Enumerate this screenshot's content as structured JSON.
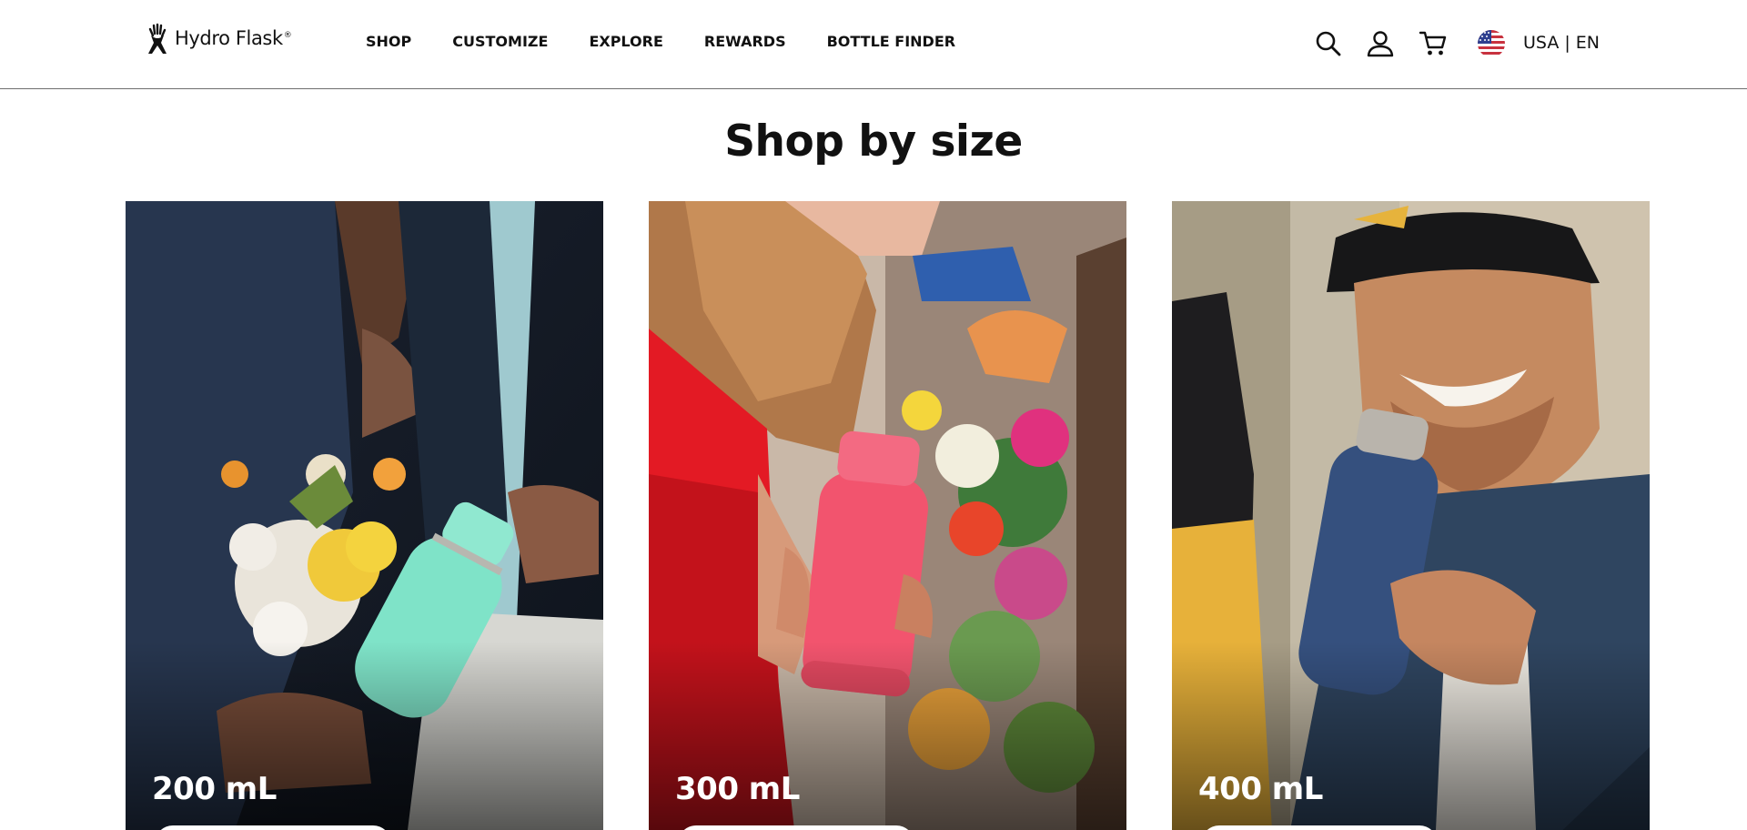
{
  "brand": {
    "name": "Hydro Flask",
    "reg": "®"
  },
  "nav": {
    "items": [
      {
        "label": "SHOP"
      },
      {
        "label": "CUSTOMIZE"
      },
      {
        "label": "EXPLORE"
      },
      {
        "label": "REWARDS"
      },
      {
        "label": "BOTTLE FINDER"
      }
    ]
  },
  "utility": {
    "search_icon": "search-icon",
    "account_icon": "user-icon",
    "cart_icon": "cart-icon",
    "flag_icon": "us-flag-icon",
    "locale": "USA | EN"
  },
  "section": {
    "title": "Shop by size"
  },
  "cards": [
    {
      "label": "200 mL",
      "bottle_color": "#7fe3c8"
    },
    {
      "label": "300 mL",
      "bottle_color": "#f2546e"
    },
    {
      "label": "400 mL",
      "bottle_color": "#35507e"
    }
  ]
}
